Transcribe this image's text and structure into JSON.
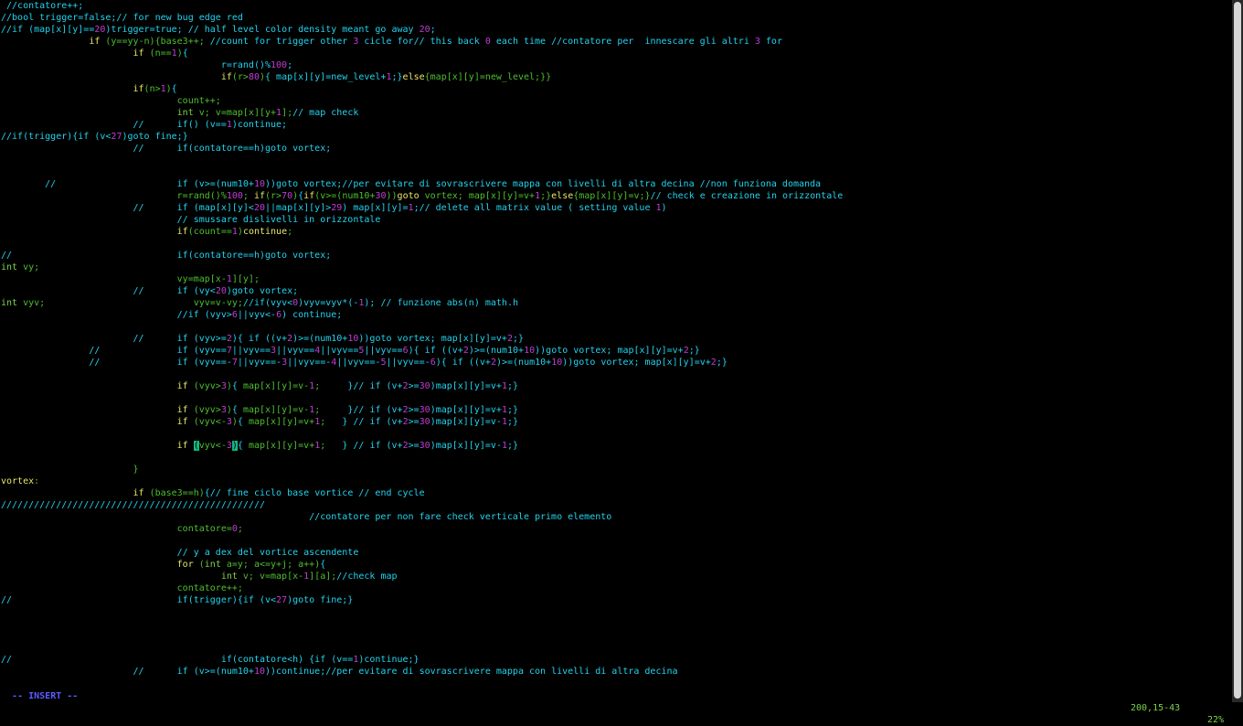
{
  "editor": {
    "lines": [
      [
        [
          "c",
          " //contatore++;"
        ]
      ],
      [
        [
          "c",
          "//bool trigger=false;// for new bug edge red"
        ]
      ],
      [
        [
          "c",
          "//if (map[x][y]=="
        ],
        [
          "n",
          "20"
        ],
        [
          "c",
          ")trigger=true; // half level color density meant go away "
        ],
        [
          "n",
          "20"
        ],
        [
          "c",
          ";"
        ]
      ],
      [
        [
          "k",
          "                if "
        ],
        [
          "g",
          "(y==yy-n){base3++; "
        ],
        [
          "c",
          "//count for trigger other "
        ],
        [
          "n",
          "3"
        ],
        [
          "c",
          " cicle for// this back "
        ],
        [
          "n",
          "0"
        ],
        [
          "c",
          " each time //contatore per  innescare gli altri "
        ],
        [
          "n",
          "3"
        ],
        [
          "c",
          " for"
        ]
      ],
      [
        [
          "k",
          "                        if "
        ],
        [
          "g",
          "(n=="
        ],
        [
          "n",
          "1"
        ],
        [
          "g",
          ")"
        ],
        [
          "c",
          "{"
        ]
      ],
      [
        [
          "c",
          "                                        r=rand()%"
        ],
        [
          "n",
          "100"
        ],
        [
          "c",
          ";"
        ]
      ],
      [
        [
          "k",
          "                                        if"
        ],
        [
          "g",
          "(r>"
        ],
        [
          "n",
          "80"
        ],
        [
          "g",
          ")"
        ],
        [
          "c",
          "{ map[x][y]=new_level+"
        ],
        [
          "n",
          "1"
        ],
        [
          "c",
          ";}"
        ],
        [
          "k",
          "else"
        ],
        [
          "g",
          "{map[x][y]=new_level;}}"
        ]
      ],
      [
        [
          "k",
          "                        if"
        ],
        [
          "g",
          "(n>"
        ],
        [
          "n",
          "1"
        ],
        [
          "g",
          ")"
        ],
        [
          "c",
          "{"
        ]
      ],
      [
        [
          "g",
          "                                count++;"
        ]
      ],
      [
        [
          "t",
          "                                int "
        ],
        [
          "g",
          "v; v=map[x][y+"
        ],
        [
          "n",
          "1"
        ],
        [
          "g",
          "];"
        ],
        [
          "c",
          "// map check"
        ]
      ],
      [
        [
          "c",
          "                        //      if() (v=="
        ],
        [
          "n",
          "1"
        ],
        [
          "c",
          ")continue;"
        ]
      ],
      [
        [
          "c",
          "//if(trigger){if (v<"
        ],
        [
          "n",
          "27"
        ],
        [
          "c",
          ")goto fine;}"
        ]
      ],
      [
        [
          "c",
          "                        //      if(contatore==h)goto vortex;"
        ]
      ],
      [
        [
          "c",
          ""
        ]
      ],
      [
        [
          "c",
          ""
        ]
      ],
      [
        [
          "c",
          "        //                      if (v>=(num10+"
        ],
        [
          "n",
          "10"
        ],
        [
          "c",
          "))goto vortex;//per evitare di sovrascrivere mappa con livelli di altra decina //non funziona domanda"
        ]
      ],
      [
        [
          "g",
          "                                r=rand()%"
        ],
        [
          "n",
          "100"
        ],
        [
          "g",
          "; "
        ],
        [
          "k",
          "if"
        ],
        [
          "g",
          "(r>"
        ],
        [
          "n",
          "70"
        ],
        [
          "g",
          ")"
        ],
        [
          "c",
          "{"
        ],
        [
          "k",
          "if"
        ],
        [
          "g",
          "(v>=(num10+"
        ],
        [
          "n",
          "30"
        ],
        [
          "g",
          "))"
        ],
        [
          "k",
          "goto"
        ],
        [
          "g",
          " vortex; map[x][y]=v+"
        ],
        [
          "n",
          "1"
        ],
        [
          "g",
          ";}"
        ],
        [
          "k",
          "else"
        ],
        [
          "g",
          "{map[x][y]=v;}"
        ],
        [
          "c",
          "// check e creazione in orizzontale"
        ]
      ],
      [
        [
          "c",
          "                        //      if (map[x][y]<"
        ],
        [
          "n",
          "20"
        ],
        [
          "c",
          "||map[x][y]>"
        ],
        [
          "n",
          "29"
        ],
        [
          "c",
          ") map[x][y]="
        ],
        [
          "n",
          "1"
        ],
        [
          "c",
          ";// delete all matrix value ( setting value "
        ],
        [
          "n",
          "1"
        ],
        [
          "c",
          ")"
        ]
      ],
      [
        [
          "c",
          "                                // smussare dislivelli in orizzontale"
        ]
      ],
      [
        [
          "k",
          "                                if"
        ],
        [
          "g",
          "(count=="
        ],
        [
          "n",
          "1"
        ],
        [
          "g",
          ")"
        ],
        [
          "k",
          "continue"
        ],
        [
          "g",
          ";"
        ]
      ],
      [
        [
          "c",
          ""
        ]
      ],
      [
        [
          "c",
          "//                              if(contatore==h)goto vortex;"
        ]
      ],
      [
        [
          "t",
          "int "
        ],
        [
          "g",
          "vy;"
        ]
      ],
      [
        [
          "g",
          "                                vy=map[x-"
        ],
        [
          "n",
          "1"
        ],
        [
          "g",
          "][y];"
        ]
      ],
      [
        [
          "c",
          "                        //      if (vy<"
        ],
        [
          "n",
          "20"
        ],
        [
          "c",
          ")goto vortex;"
        ]
      ],
      [
        [
          "t",
          "int "
        ],
        [
          "g",
          "vyv;                           vyv=v-vy;"
        ],
        [
          "c",
          "//if(vyv<"
        ],
        [
          "n",
          "0"
        ],
        [
          "c",
          ")vyv=vyv*(-"
        ],
        [
          "n",
          "1"
        ],
        [
          "c",
          "); // funzione abs(n) math.h"
        ]
      ],
      [
        [
          "c",
          "                                //if (vyv>"
        ],
        [
          "n",
          "6"
        ],
        [
          "c",
          "||vyv<-"
        ],
        [
          "n",
          "6"
        ],
        [
          "c",
          ") continue;"
        ]
      ],
      [
        [
          "c",
          ""
        ]
      ],
      [
        [
          "c",
          "                        //      if (vyv>="
        ],
        [
          "n",
          "2"
        ],
        [
          "c",
          "){ if ((v+"
        ],
        [
          "n",
          "2"
        ],
        [
          "c",
          ")>=(num10+"
        ],
        [
          "n",
          "10"
        ],
        [
          "c",
          "))goto vortex; map[x][y]=v+"
        ],
        [
          "n",
          "2"
        ],
        [
          "c",
          ";}"
        ]
      ],
      [
        [
          "c",
          "                //              if (vyv=="
        ],
        [
          "n",
          "7"
        ],
        [
          "c",
          "||vyv=="
        ],
        [
          "n",
          "3"
        ],
        [
          "c",
          "||vyv=="
        ],
        [
          "n",
          "4"
        ],
        [
          "c",
          "||vyv=="
        ],
        [
          "n",
          "5"
        ],
        [
          "c",
          "||vyv=="
        ],
        [
          "n",
          "6"
        ],
        [
          "c",
          "){ if ((v+"
        ],
        [
          "n",
          "2"
        ],
        [
          "c",
          ")>=(num10+"
        ],
        [
          "n",
          "10"
        ],
        [
          "c",
          "))goto vortex; map[x][y]=v+"
        ],
        [
          "n",
          "2"
        ],
        [
          "c",
          ";}"
        ]
      ],
      [
        [
          "c",
          "                //              if (vyv==-"
        ],
        [
          "n",
          "7"
        ],
        [
          "c",
          "||vyv==-"
        ],
        [
          "n",
          "3"
        ],
        [
          "c",
          "||vyv==-"
        ],
        [
          "n",
          "4"
        ],
        [
          "c",
          "||vyv==-"
        ],
        [
          "n",
          "5"
        ],
        [
          "c",
          "||vyv==-"
        ],
        [
          "n",
          "6"
        ],
        [
          "c",
          "){ if ((v+"
        ],
        [
          "n",
          "2"
        ],
        [
          "c",
          ")>=(num10+"
        ],
        [
          "n",
          "10"
        ],
        [
          "c",
          "))goto vortex; map[x][y]=v+"
        ],
        [
          "n",
          "2"
        ],
        [
          "c",
          ";}"
        ]
      ],
      [
        [
          "c",
          ""
        ]
      ],
      [
        [
          "k",
          "                                if "
        ],
        [
          "g",
          "(vyv>"
        ],
        [
          "n",
          "3"
        ],
        [
          "g",
          ")"
        ],
        [
          "c",
          "{ "
        ],
        [
          "g",
          "map[x][y]=v-"
        ],
        [
          "n",
          "1"
        ],
        [
          "g",
          ";     "
        ],
        [
          "c",
          "}// if (v+"
        ],
        [
          "n",
          "2"
        ],
        [
          "c",
          ">="
        ],
        [
          "n",
          "30"
        ],
        [
          "c",
          ")map[x][y]=v+"
        ],
        [
          "n",
          "1"
        ],
        [
          "c",
          ";}"
        ]
      ],
      [
        [
          "c",
          ""
        ]
      ],
      [
        [
          "k",
          "                                if "
        ],
        [
          "g",
          "(vyv>"
        ],
        [
          "n",
          "3"
        ],
        [
          "g",
          ")"
        ],
        [
          "c",
          "{ "
        ],
        [
          "g",
          "map[x][y]=v-"
        ],
        [
          "n",
          "1"
        ],
        [
          "g",
          ";     "
        ],
        [
          "c",
          "}// if (v+"
        ],
        [
          "n",
          "2"
        ],
        [
          "c",
          ">="
        ],
        [
          "n",
          "30"
        ],
        [
          "c",
          ")map[x][y]=v+"
        ],
        [
          "n",
          "1"
        ],
        [
          "c",
          ";}"
        ]
      ],
      [
        [
          "k",
          "                                if "
        ],
        [
          "g",
          "(vyv<-"
        ],
        [
          "n",
          "3"
        ],
        [
          "g",
          ")"
        ],
        [
          "c",
          "{ "
        ],
        [
          "g",
          "map[x][y]=v+"
        ],
        [
          "n",
          "1"
        ],
        [
          "g",
          ";   "
        ],
        [
          "c",
          "} // if (v+"
        ],
        [
          "n",
          "2"
        ],
        [
          "c",
          ">="
        ],
        [
          "n",
          "30"
        ],
        [
          "c",
          ")map[x][y]=v-"
        ],
        [
          "n",
          "1"
        ],
        [
          "c",
          ";}"
        ]
      ],
      [
        [
          "c",
          ""
        ]
      ],
      [
        [
          "k",
          "                                if "
        ],
        [
          "cur",
          "("
        ],
        [
          "g",
          "vyv<-"
        ],
        [
          "n",
          "3"
        ],
        [
          "cur",
          ")"
        ],
        [
          "c",
          "{ "
        ],
        [
          "g",
          "map[x][y]=v+"
        ],
        [
          "n",
          "1"
        ],
        [
          "g",
          ";   "
        ],
        [
          "c",
          "} // if (v+"
        ],
        [
          "n",
          "2"
        ],
        [
          "c",
          ">="
        ],
        [
          "n",
          "30"
        ],
        [
          "c",
          ")map[x][y]=v-"
        ],
        [
          "n",
          "1"
        ],
        [
          "c",
          ";}"
        ]
      ],
      [
        [
          "c",
          ""
        ]
      ],
      [
        [
          "g",
          "                        }"
        ]
      ],
      [
        [
          "k",
          "vortex"
        ],
        [
          "g",
          ":"
        ]
      ],
      [
        [
          "k",
          "                        if "
        ],
        [
          "g",
          "(base3==h)"
        ],
        [
          "c",
          "{// fine ciclo base vortice // end cycle"
        ]
      ],
      [
        [
          "c",
          "////////////////////////////////////////////////"
        ]
      ],
      [
        [
          "c",
          "                                                        //contatore per non fare check verticale primo elemento"
        ]
      ],
      [
        [
          "g",
          "                                contatore="
        ],
        [
          "n",
          "0"
        ],
        [
          "g",
          ";"
        ]
      ],
      [
        [
          "c",
          ""
        ]
      ],
      [
        [
          "c",
          "                                // y a dex del vortice ascendente"
        ]
      ],
      [
        [
          "k",
          "                                for "
        ],
        [
          "g",
          "("
        ],
        [
          "t",
          "int "
        ],
        [
          "g",
          "a=y; a<=y+j; a++)"
        ],
        [
          "c",
          "{"
        ]
      ],
      [
        [
          "t",
          "                                        int "
        ],
        [
          "g",
          "v; v=map[x-"
        ],
        [
          "n",
          "1"
        ],
        [
          "g",
          "][a];"
        ],
        [
          "c",
          "//check map"
        ]
      ],
      [
        [
          "g",
          "                                contatore++;"
        ]
      ],
      [
        [
          "c",
          "//                              if(trigger){if (v<"
        ],
        [
          "n",
          "27"
        ],
        [
          "c",
          ")goto fine;}"
        ]
      ],
      [
        [
          "c",
          ""
        ]
      ],
      [
        [
          "c",
          ""
        ]
      ],
      [
        [
          "c",
          ""
        ]
      ],
      [
        [
          "c",
          ""
        ]
      ],
      [
        [
          "c",
          "//                                      if(contatore<h) {if (v=="
        ],
        [
          "n",
          "1"
        ],
        [
          "c",
          ")continue;}"
        ]
      ],
      [
        [
          "c",
          "                        //      if (v>=(num10+"
        ],
        [
          "n",
          "10"
        ],
        [
          "c",
          "))continue;//per evitare di sovrascrivere mappa con livelli di altra decina"
        ]
      ]
    ]
  },
  "status": {
    "mode": "-- INSERT --",
    "position": "200,15-43",
    "percent": "22%"
  },
  "colors": {
    "background": "#000000",
    "comment": "#22d3ee",
    "keyword": "#e9e66a",
    "type": "#7fd14a",
    "number": "#c23bd6",
    "code": "#4fbf2f",
    "cursor": "#10b981",
    "mode": "#5b5bff"
  }
}
